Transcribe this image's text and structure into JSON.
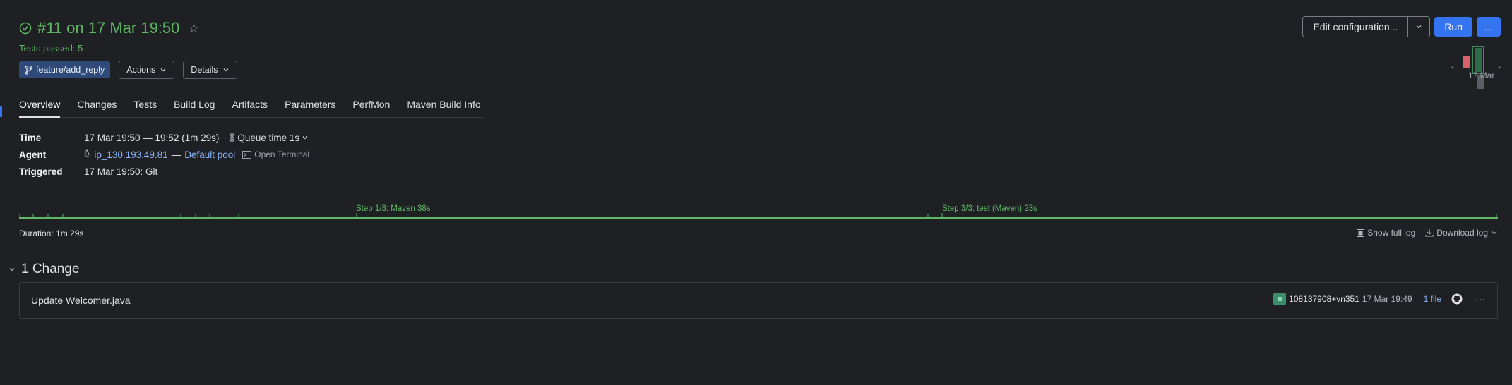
{
  "build": {
    "title": "#11 on 17 Mar 19:50",
    "status": "Tests passed: 5",
    "status_color": "#5fb865",
    "branch": "feature/add_reply",
    "actions_label": "Actions",
    "details_label": "Details"
  },
  "toolbar": {
    "edit_label": "Edit configuration...",
    "run_label": "Run",
    "more_label": "...",
    "accent": "#3574f0"
  },
  "history": {
    "date_label": "17 Mar"
  },
  "tabs": [
    {
      "label": "Overview",
      "active": true
    },
    {
      "label": "Changes"
    },
    {
      "label": "Tests"
    },
    {
      "label": "Build Log"
    },
    {
      "label": "Artifacts"
    },
    {
      "label": "Parameters"
    },
    {
      "label": "PerfMon"
    },
    {
      "label": "Maven Build Info"
    }
  ],
  "info": {
    "time_label": "Time",
    "time_value": "17 Mar 19:50 — 19:52 (1m 29s)",
    "queue_value": "Queue time 1s",
    "agent_label": "Agent",
    "agent_name": "ip_130.193.49.81",
    "agent_sep": "—",
    "agent_pool": "Default pool",
    "open_terminal": "Open Terminal",
    "triggered_label": "Triggered",
    "triggered_value": "17 Mar 19:50: Git"
  },
  "timeline": {
    "step1": "Step 1/3: Maven 38s",
    "step3": "Step 3/3: test (Maven) 23s",
    "duration": "Duration: 1m 29s",
    "show_full_log": "Show full log",
    "download_log": "Download log"
  },
  "changes": {
    "header": "1 Change",
    "items": [
      {
        "title": "Update Welcomer.java",
        "author": "108137908+vn351",
        "time": "17 Mar 19:49",
        "files": "1 file"
      }
    ]
  }
}
